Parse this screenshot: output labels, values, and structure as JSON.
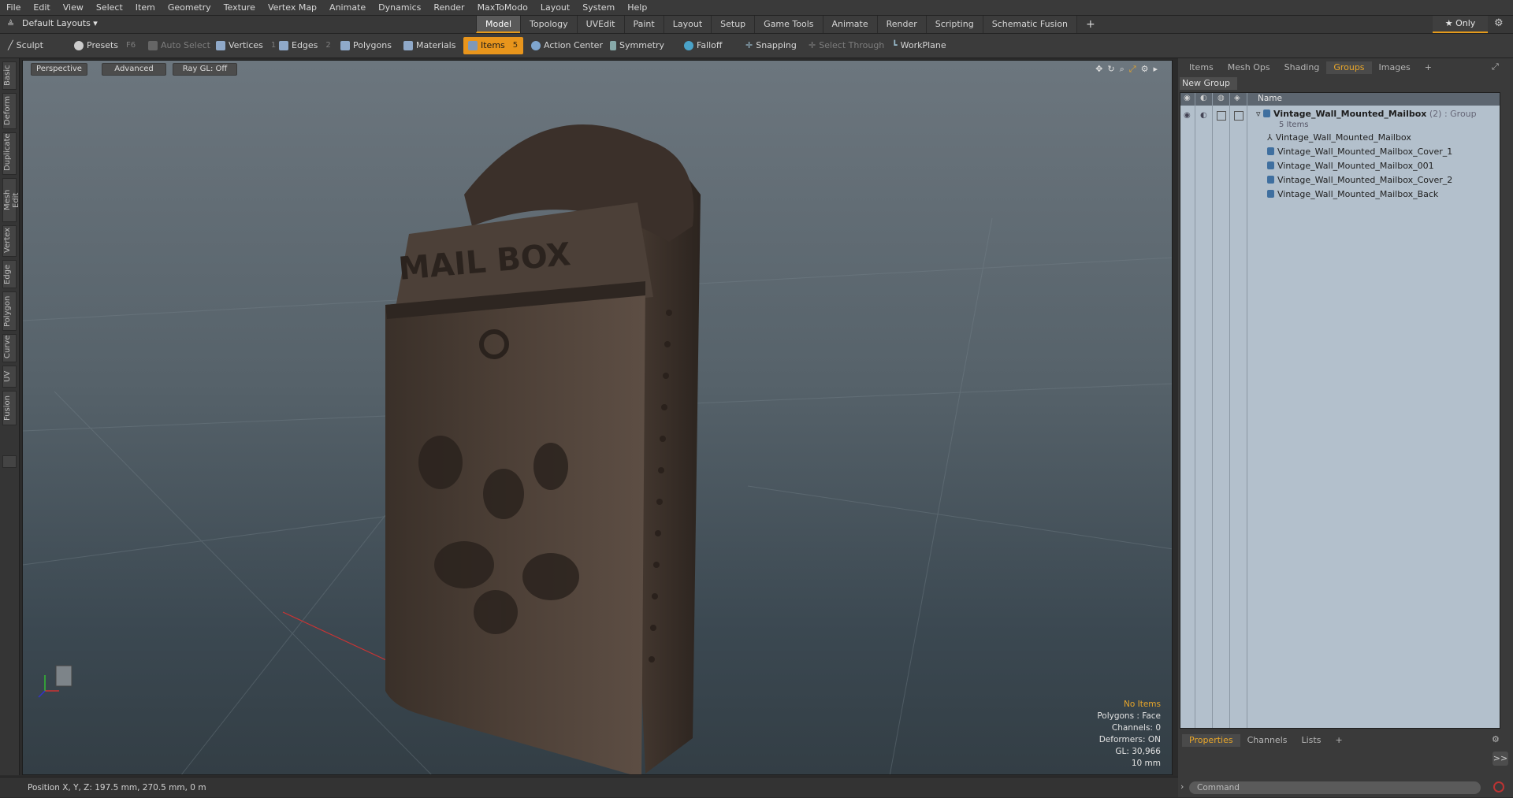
{
  "menu": [
    "File",
    "Edit",
    "View",
    "Select",
    "Item",
    "Geometry",
    "Texture",
    "Vertex Map",
    "Animate",
    "Dynamics",
    "Render",
    "MaxToModo",
    "Layout",
    "System",
    "Help"
  ],
  "layout_selector": "Default Layouts ▾",
  "mode_tabs": [
    {
      "label": "Model",
      "active": true
    },
    {
      "label": "Topology",
      "active": false
    },
    {
      "label": "UVEdit",
      "active": false
    },
    {
      "label": "Paint",
      "active": false
    },
    {
      "label": "Layout",
      "active": false
    },
    {
      "label": "Setup",
      "active": false
    },
    {
      "label": "Game Tools",
      "active": false
    },
    {
      "label": "Animate",
      "active": false
    },
    {
      "label": "Render",
      "active": false
    },
    {
      "label": "Scripting",
      "active": false
    },
    {
      "label": "Schematic Fusion",
      "active": false
    }
  ],
  "add_tab": "+",
  "only_button": "★  Only",
  "toolbar": {
    "sculpt": "Sculpt",
    "presets": "Presets",
    "presets_key": "F6",
    "auto_select": "Auto Select",
    "vertices": "Vertices",
    "vertices_key": "1",
    "edges": "Edges",
    "edges_key": "2",
    "polygons": "Polygons",
    "materials": "Materials",
    "items": "Items",
    "items_key": "5",
    "action_center": "Action Center",
    "symmetry": "Symmetry",
    "falloff": "Falloff",
    "snapping": "Snapping",
    "select_through": "Select Through",
    "workplane": "WorkPlane"
  },
  "left_tabs": [
    "Basic",
    "Deform",
    "Duplicate",
    "Mesh Edit",
    "Vertex",
    "Edge",
    "Polygon",
    "Curve",
    "UV",
    "Fusion"
  ],
  "viewport": {
    "view": "Perspective",
    "shading": "Advanced",
    "raygl": "Ray GL: Off",
    "model_label": "MAIL BOX",
    "info": {
      "line1": "No Items",
      "line2": "Polygons : Face",
      "line3": "Channels: 0",
      "line4": "Deformers: ON",
      "line5": "GL: 30,966",
      "line6": "10 mm"
    }
  },
  "status": "Position X, Y, Z:   197.5 mm, 270.5 mm, 0 m",
  "right_panel": {
    "tabs": [
      {
        "label": "Items",
        "active": false
      },
      {
        "label": "Mesh Ops",
        "active": false
      },
      {
        "label": "Shading",
        "active": false
      },
      {
        "label": "Groups",
        "active": true
      },
      {
        "label": "Images",
        "active": false
      }
    ],
    "add": "+",
    "new_group": "New Group",
    "column_name": "Name",
    "group": {
      "name": "Vintage_Wall_Mounted_Mailbox",
      "count_suffix": " (2) : Group",
      "items_label": "5 Items"
    },
    "items": [
      "Vintage_Wall_Mounted_Mailbox",
      "Vintage_Wall_Mounted_Mailbox_Cover_1",
      "Vintage_Wall_Mounted_Mailbox_001",
      "Vintage_Wall_Mounted_Mailbox_Cover_2",
      "Vintage_Wall_Mounted_Mailbox_Back"
    ],
    "bottom_tabs": [
      {
        "label": "Properties",
        "active": true
      },
      {
        "label": "Channels",
        "active": false
      },
      {
        "label": "Lists",
        "active": false
      }
    ],
    "command_placeholder": "Command",
    "expand": ">>"
  },
  "colors": {
    "accent": "#e8951c",
    "tree_bg": "#b3c0cc"
  }
}
